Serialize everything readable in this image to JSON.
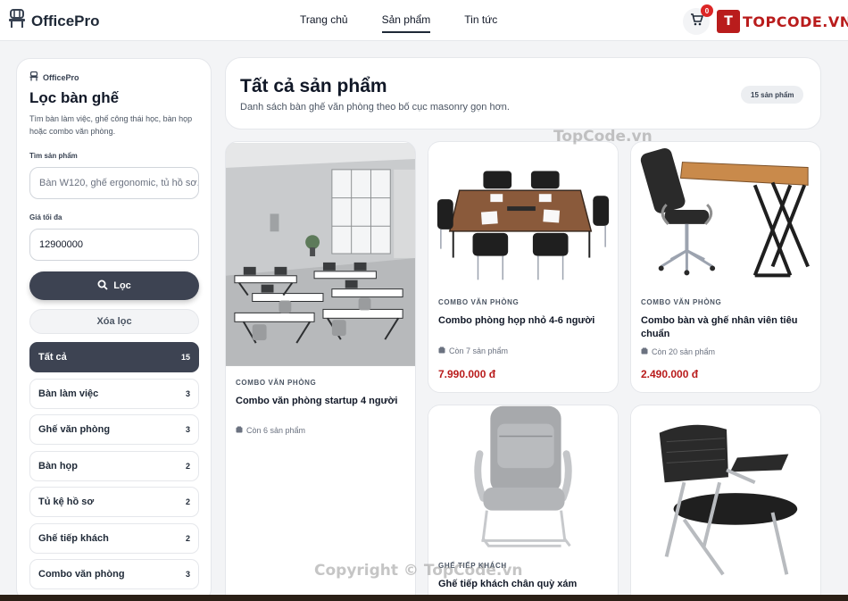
{
  "header": {
    "brand": "OfficePro",
    "nav": [
      {
        "label": "Trang chủ",
        "active": false
      },
      {
        "label": "Sản phẩm",
        "active": true
      },
      {
        "label": "Tin tức",
        "active": false
      }
    ],
    "cart_count": "0",
    "partner_logo": {
      "mark": "T",
      "word": "TOPCODE.VN"
    }
  },
  "sidebar": {
    "brand": "OfficePro",
    "title": "Lọc bàn ghế",
    "desc": "Tìm bàn làm việc, ghế công thái học, bàn họp hoặc combo văn phòng.",
    "search_label": "Tìm sản phẩm",
    "search_placeholder": "Bàn W120, ghế ergonomic, tủ hồ sơ...",
    "price_label": "Giá tối đa",
    "price_value": "12900000",
    "filter_button": "Lọc",
    "clear_button": "Xóa lọc",
    "categories": [
      {
        "label": "Tất cả",
        "count": "15",
        "active": true
      },
      {
        "label": "Bàn làm việc",
        "count": "3",
        "active": false
      },
      {
        "label": "Ghế văn phòng",
        "count": "3",
        "active": false
      },
      {
        "label": "Bàn họp",
        "count": "2",
        "active": false
      },
      {
        "label": "Tủ kệ hồ sơ",
        "count": "2",
        "active": false
      },
      {
        "label": "Ghế tiếp khách",
        "count": "2",
        "active": false
      },
      {
        "label": "Combo văn phòng",
        "count": "3",
        "active": false
      }
    ]
  },
  "main": {
    "title": "Tất cả sản phẩm",
    "subtitle": "Danh sách bàn ghế văn phòng theo bố cục masonry gọn hơn.",
    "count_badge": "15 sản phẩm"
  },
  "products": [
    {
      "category": "COMBO VĂN PHÒNG",
      "name": "Combo văn phòng startup 4 người",
      "stock": "Còn 6 sản phẩm",
      "price": ""
    },
    {
      "category": "COMBO VĂN PHÒNG",
      "name": "Combo phòng họp nhỏ 4-6 người",
      "stock": "Còn 7 sản phẩm",
      "price": "7.990.000 đ"
    },
    {
      "category": "COMBO VĂN PHÒNG",
      "name": "Combo bàn và ghế nhân viên tiêu chuẩn",
      "stock": "Còn 20 sản phẩm",
      "price": "2.490.000 đ"
    },
    {
      "category": "GHẾ TIẾP KHÁCH",
      "name": "Ghế tiếp khách chân quỳ xám",
      "stock": "",
      "price": ""
    },
    {
      "category": "",
      "name": "",
      "stock": "",
      "price": ""
    }
  ],
  "watermarks": {
    "top": "TopCode.vn",
    "bottom": "Copyright © TopCode.vn"
  },
  "colors": {
    "accent_dark": "#3d4352",
    "price": "#b91c1c",
    "badge": "#dc2626"
  }
}
